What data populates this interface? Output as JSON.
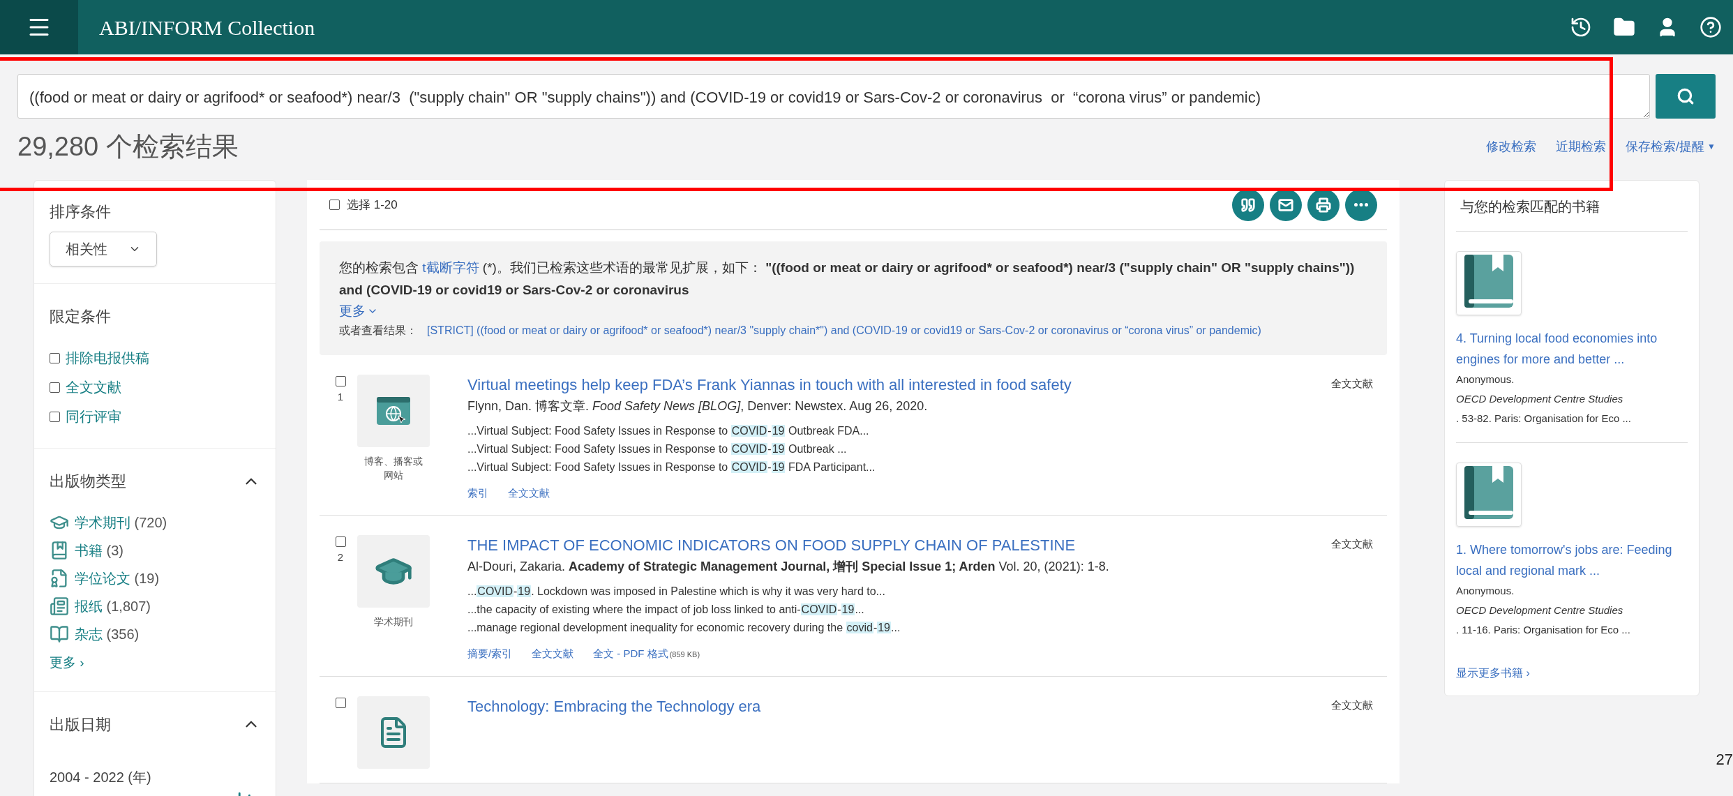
{
  "header": {
    "title": "ABI/INFORM Collection"
  },
  "search": {
    "value": "((food or meat or dairy or agrifood* or seafood*) near/3  (\"supply chain\" OR \"supply chains\")) and (COVID-19 or covid19 or Sars-Cov-2 or coronavirus  or  “corona virus” or pandemic)"
  },
  "result_count": "29,280 个检索结果",
  "search_links": [
    "修改检索",
    "近期检索",
    "保存检索/提醒"
  ],
  "search_links_caret": "▼",
  "sidebar": {
    "sort_label": "排序条件",
    "sort_value": "相关性",
    "limit_label": "限定条件",
    "limits": [
      {
        "label": "排除电报供稿",
        "checked": false
      },
      {
        "label": "全文文献",
        "checked": false
      },
      {
        "label": "同行评审",
        "checked": false
      }
    ],
    "pub_type_label": "出版物类型",
    "pub_type_expanded": true,
    "pub_types": [
      {
        "kind": "journal",
        "label": "学术期刊",
        "count": "(720)"
      },
      {
        "kind": "book",
        "label": "书籍",
        "count": "(3)"
      },
      {
        "kind": "thesis",
        "label": "学位论文",
        "count": "(19)"
      },
      {
        "kind": "newspaper",
        "label": "报纸",
        "count": "(1,807)"
      },
      {
        "kind": "magazine",
        "label": "杂志",
        "count": "(356)"
      }
    ],
    "more": "更多 ›",
    "date_label": "出版日期",
    "date_expanded": true,
    "date_range": "2004 - 2022 (年)"
  },
  "toolbar": {
    "select_label": "选择 1-20",
    "select_checked": false
  },
  "notice": {
    "prefix": "您的检索包含 ",
    "link": "t截断字符",
    "text": " (*)。我们已检索这些术语的最常见扩展，如下：  **\"((food or meat or dairy or agrifood* or seafood*) near/3 (\"supply chain\" OR \"supply chains\")) and (COVID-19 or covid19 or Sars-Cov-2 or coronavirus**",
    "more": "更多",
    "alt_label": "或者查看结果：",
    "alt_link": "[STRICT] ((food or meat or dairy or agrifood* or seafood*) near/3 \"supply chain*\") and (COVID-19 or covid19 or Sars-Cov-2 or coronavirus or “corona virus” or pandemic)"
  },
  "results": [
    {
      "number": "1",
      "checked": false,
      "kind": "blog",
      "type_label": "博客、播客或网站",
      "title": "Virtual meetings help keep FDA’s Frank Yiannas in touch with all interested in food safety",
      "citation": "Flynn, Dan. 博客文章. *Food Safety News [BLOG]*, Denver: Newstex. Aug 26, 2020.",
      "availability": "全文文献",
      "snippets": [
        [
          {
            "text": "...Virtual Subject: Food Safety Issues in Response to ",
            "highlighted": false
          },
          {
            "text": "COVID",
            "highlighted": true
          },
          {
            "text": "-",
            "highlighted": false
          },
          {
            "text": "19",
            "highlighted": true
          },
          {
            "text": " Outbreak FDA...",
            "highlighted": false
          }
        ],
        [
          {
            "text": "...Virtual Subject: Food Safety Issues in Response to ",
            "highlighted": false
          },
          {
            "text": "COVID",
            "highlighted": true
          },
          {
            "text": "-",
            "highlighted": false
          },
          {
            "text": "19",
            "highlighted": true
          },
          {
            "text": " Outbreak ...",
            "highlighted": false
          }
        ],
        [
          {
            "text": "...Virtual Subject: Food Safety Issues in Response to ",
            "highlighted": false
          },
          {
            "text": "COVID",
            "highlighted": true
          },
          {
            "text": "-",
            "highlighted": false
          },
          {
            "text": "19",
            "highlighted": true
          },
          {
            "text": " FDA Participant...",
            "highlighted": false
          }
        ]
      ],
      "links": [
        {
          "label": "索引"
        },
        {
          "label": "全文文献"
        }
      ]
    },
    {
      "number": "2",
      "checked": false,
      "kind": "journal",
      "type_label": "学术期刊",
      "title": "THE IMPACT OF ECONOMIC INDICATORS ON FOOD SUPPLY CHAIN OF PALESTINE",
      "citation": "Al-Douri, Zakaria. **Academy of Strategic Management Journal, 增刊 Special Issue 1; Arden** Vol. 20,  (2021): 1-8.",
      "availability": "全文文献",
      "snippets": [
        [
          {
            "text": "...",
            "highlighted": false
          },
          {
            "text": "COVID",
            "highlighted": true
          },
          {
            "text": "-",
            "highlighted": false
          },
          {
            "text": "19",
            "highlighted": true
          },
          {
            "text": ". Lockdown was imposed in Palestine which is why it was very hard to...",
            "highlighted": false
          }
        ],
        [
          {
            "text": "...the capacity of existing where the impact of job loss linked to anti-",
            "highlighted": false
          },
          {
            "text": "COVID",
            "highlighted": true
          },
          {
            "text": "-",
            "highlighted": false
          },
          {
            "text": "19",
            "highlighted": true
          },
          {
            "text": "...",
            "highlighted": false
          }
        ],
        [
          {
            "text": "...manage regional development inequality for economic recovery during the ",
            "highlighted": false
          },
          {
            "text": "covid",
            "highlighted": true
          },
          {
            "text": "-",
            "highlighted": false
          },
          {
            "text": "19",
            "highlighted": true
          },
          {
            "text": "...",
            "highlighted": false
          }
        ]
      ],
      "links": [
        {
          "label": "摘要/索引"
        },
        {
          "label": "全文文献"
        },
        {
          "label": "全文 - PDF 格式",
          "note": "(859 KB)"
        }
      ]
    },
    {
      "checked": false,
      "kind": "other",
      "title": "Technology: Embracing the Technology era",
      "availability": "全文文献"
    }
  ],
  "books": {
    "title": "与您的检索匹配的书籍",
    "items": [
      {
        "title": "4. Turning local food economies into engines for more and better ...",
        "author": "Anonymous.",
        "series": "OECD Development Centre Studies",
        "pages": ". 53-82. Paris: Organisation for Eco  ..."
      },
      {
        "title": "1. Where tomorrow's jobs are: Feeding local and regional mark ...",
        "author": "Anonymous.",
        "series": "OECD Development Centre Studies",
        "pages": ". 11-16. Paris: Organisation for Eco  ..."
      }
    ],
    "more": "显示更多书籍 ›"
  },
  "page_edge_text": "27"
}
